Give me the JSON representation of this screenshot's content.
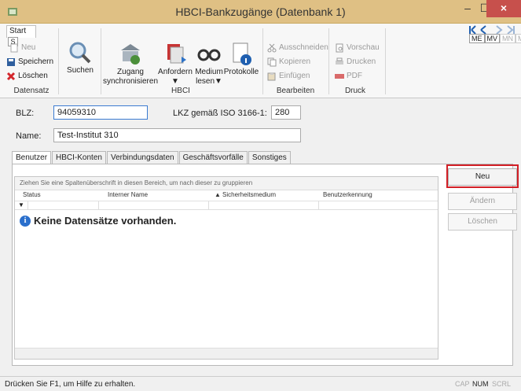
{
  "window": {
    "title": "HBCI-Bankzugänge (Datenbank 1)",
    "minimize": "–",
    "maximize": "☐",
    "close": "×"
  },
  "ribbon": {
    "tab_start": "Start",
    "keytip": "S",
    "datensatz": {
      "neu": "Neu",
      "speichern": "Speichern",
      "loeschen": "Löschen",
      "group": "Datensatz"
    },
    "suchen": "Suchen",
    "hbci": {
      "zugang_line1": "Zugang",
      "zugang_line2": "synchronisieren",
      "anfordern": "Anfordern",
      "medium_line1": "Medium",
      "medium_line2": "lesen",
      "protokolle": "Protokolle",
      "group": "HBCI"
    },
    "bearbeiten": {
      "ausschneiden": "Ausschneiden",
      "kopieren": "Kopieren",
      "einfuegen": "Einfügen",
      "group": "Bearbeiten"
    },
    "druck": {
      "vorschau": "Vorschau",
      "drucken": "Drucken",
      "pdf": "PDF",
      "group": "Druck"
    },
    "mini_tabs": [
      "ME",
      "MV",
      "MN",
      "M"
    ]
  },
  "form": {
    "blz_label": "BLZ:",
    "blz_value": "94059310",
    "lkz_label": "LKZ gemäß ISO 3166-1:",
    "lkz_value": "280",
    "name_label": "Name:",
    "name_value": "Test-Institut 310"
  },
  "tabs": [
    "Benutzer",
    "HBCI-Konten",
    "Verbindungsdaten",
    "Geschäftsvorfälle",
    "Sonstiges"
  ],
  "grid": {
    "group_hint": "Ziehen Sie eine Spaltenüberschrift in diesen Bereich, um nach dieser zu gruppieren",
    "columns": [
      "Status",
      "Interner Name",
      "Sicherheitsmedium",
      "Benutzerkennung"
    ],
    "sort_indicator": "▲",
    "empty_message": "Keine Datensätze vorhanden."
  },
  "side_buttons": {
    "neu": "Neu",
    "aendern": "Ändern",
    "loeschen": "Löschen"
  },
  "status": {
    "text": "Drücken Sie F1, um Hilfe zu erhalten.",
    "cap": "CAP",
    "num": "NUM",
    "scrl": "SCRL"
  },
  "colors": {
    "title_bar": "#dfc084",
    "close": "#c7504c",
    "highlight": "#d21f26",
    "info": "#2a6fcc"
  }
}
